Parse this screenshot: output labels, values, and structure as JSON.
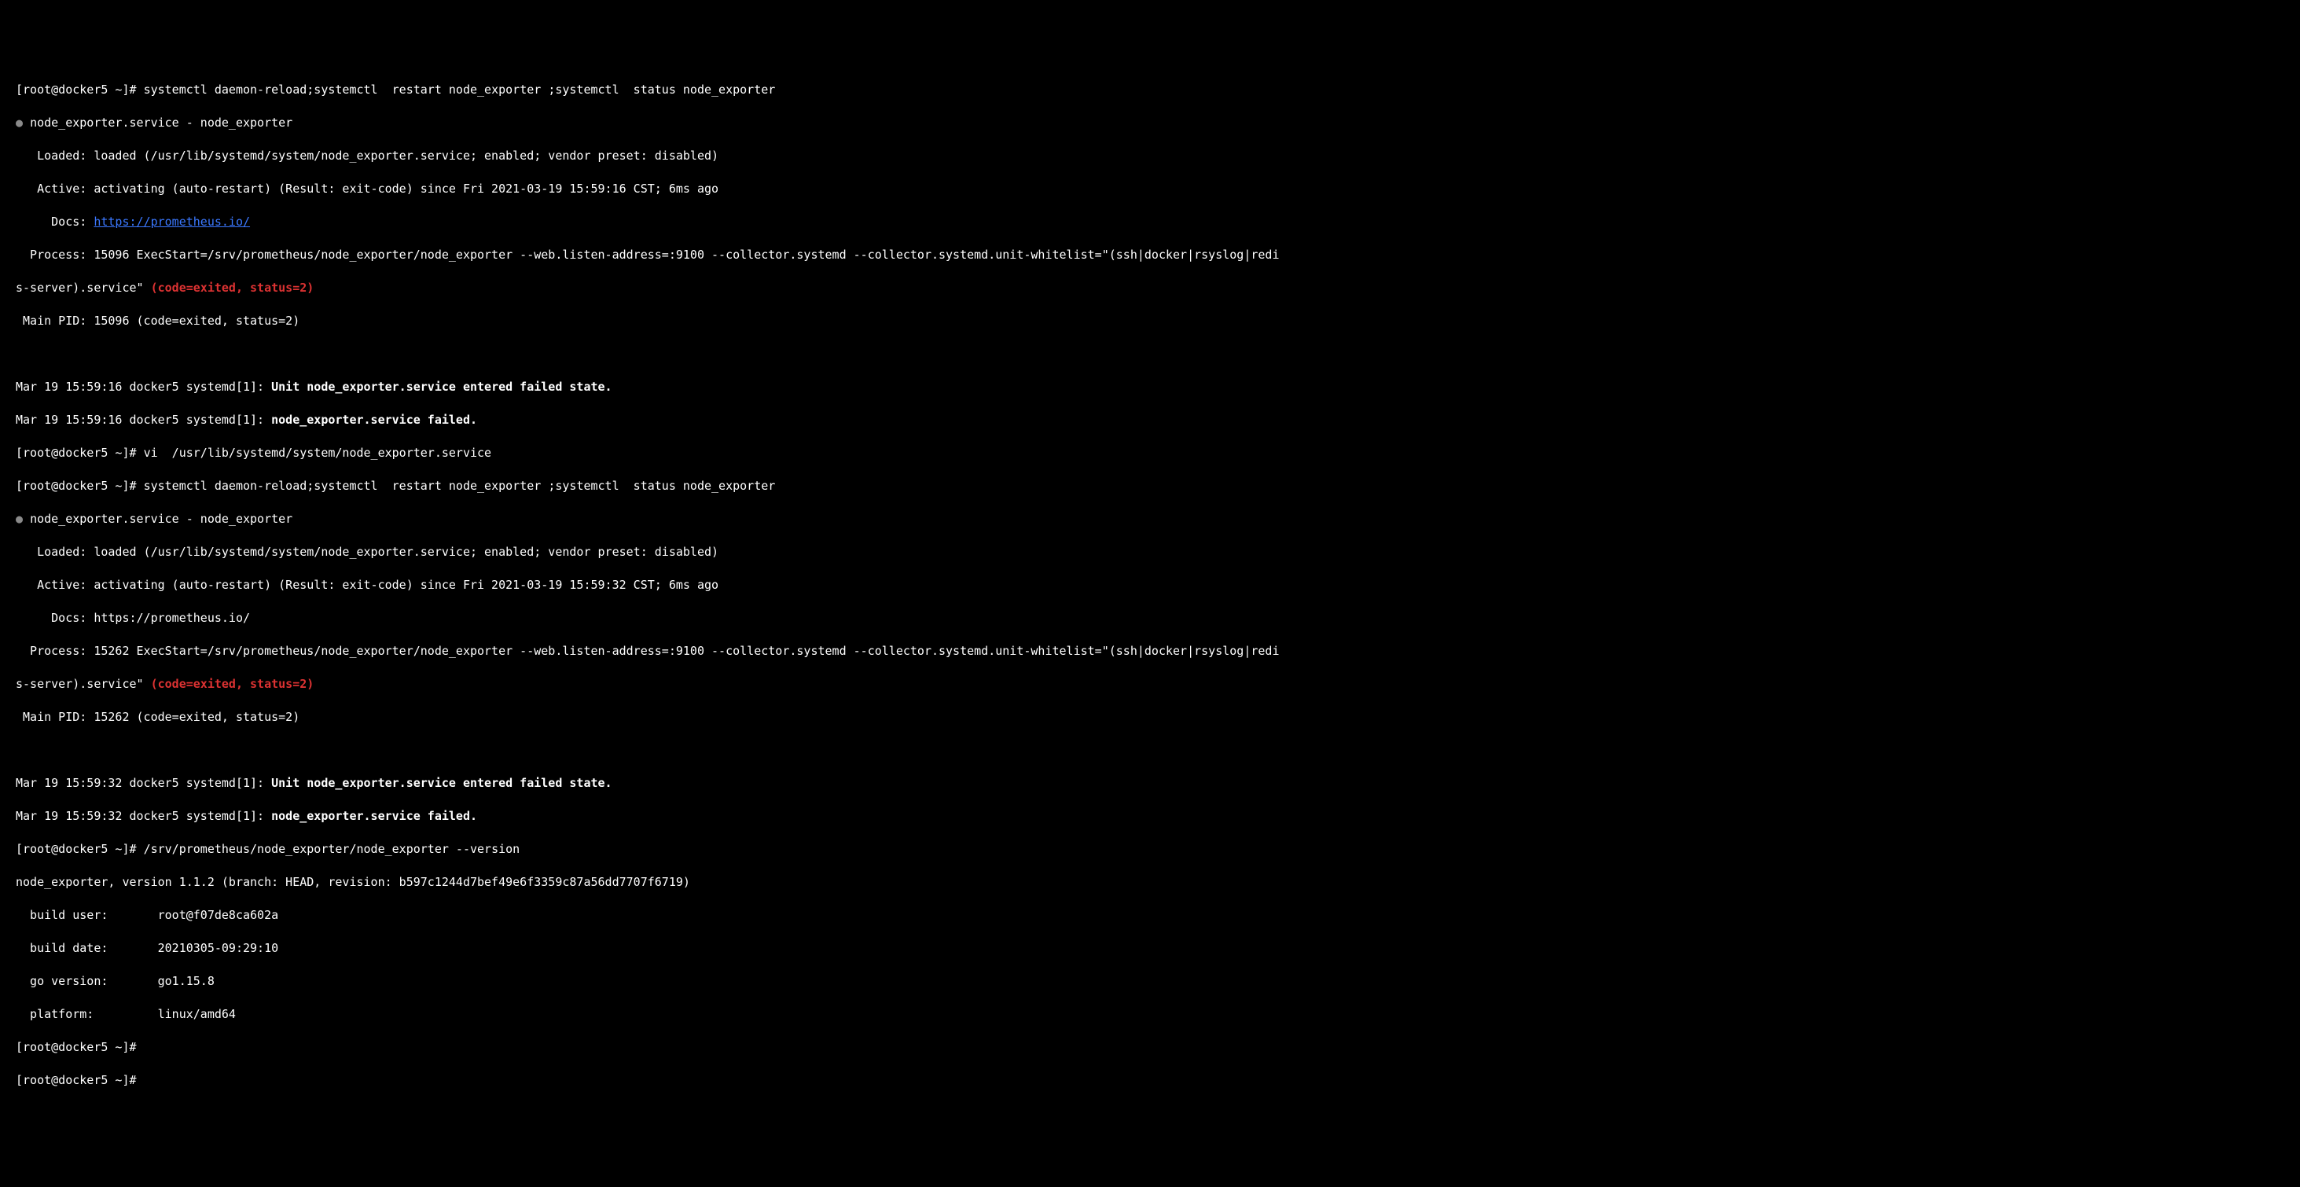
{
  "colors": {
    "bg": "#000000",
    "fg": "#ffffff",
    "red": "#dc3232",
    "link": "#3b78ff",
    "dim": "#aaaaaa"
  },
  "block1": {
    "prompt": "[root@docker5 ~]# ",
    "cmd": "systemctl daemon-reload;systemctl  restart node_exporter ;systemctl  status node_exporter",
    "bullet": "● ",
    "service_header": "node_exporter.service - node_exporter",
    "loaded": "   Loaded: loaded (/usr/lib/systemd/system/node_exporter.service; enabled; vendor preset: disabled)",
    "active": "   Active: activating (auto-restart) (Result: exit-code) since Fri 2021-03-19 15:59:16 CST; 6ms ago",
    "docs_label": "     Docs: ",
    "docs_url": "https://prometheus.io/",
    "process_a": "  Process: 15096 ExecStart=/srv/prometheus/node_exporter/node_exporter --web.listen-address=:9100 --collector.systemd --collector.systemd.unit-whitelist=\"(ssh|docker|rsyslog|redi",
    "process_b": "s-server).service\" ",
    "process_status": "(code=exited, status=2)",
    "main_pid": " Main PID: 15096 (code=exited, status=2)",
    "log1_pre": "Mar 19 15:59:16 docker5 systemd[1]: ",
    "log1_bold": "Unit node_exporter.service entered failed state.",
    "log2_pre": "Mar 19 15:59:16 docker5 systemd[1]: ",
    "log2_bold": "node_exporter.service failed."
  },
  "vi": {
    "prompt": "[root@docker5 ~]# ",
    "cmd": "vi  /usr/lib/systemd/system/node_exporter.service"
  },
  "block2": {
    "prompt": "[root@docker5 ~]# ",
    "cmd": "systemctl daemon-reload;systemctl  restart node_exporter ;systemctl  status node_exporter",
    "bullet": "● ",
    "service_header": "node_exporter.service - node_exporter",
    "loaded": "   Loaded: loaded (/usr/lib/systemd/system/node_exporter.service; enabled; vendor preset: disabled)",
    "active": "   Active: activating (auto-restart) (Result: exit-code) since Fri 2021-03-19 15:59:32 CST; 6ms ago",
    "docs": "     Docs: https://prometheus.io/",
    "process_a": "  Process: 15262 ExecStart=/srv/prometheus/node_exporter/node_exporter --web.listen-address=:9100 --collector.systemd --collector.systemd.unit-whitelist=\"(ssh|docker|rsyslog|redi",
    "process_b": "s-server).service\" ",
    "process_status": "(code=exited, status=2)",
    "main_pid": " Main PID: 15262 (code=exited, status=2)",
    "log1_pre": "Mar 19 15:59:32 docker5 systemd[1]: ",
    "log1_bold": "Unit node_exporter.service entered failed state.",
    "log2_pre": "Mar 19 15:59:32 docker5 systemd[1]: ",
    "log2_bold": "node_exporter.service failed."
  },
  "version": {
    "prompt": "[root@docker5 ~]# ",
    "cmd": "/srv/prometheus/node_exporter/node_exporter --version",
    "line": "node_exporter, version 1.1.2 (branch: HEAD, revision: b597c1244d7bef49e6f3359c87a56dd7707f6719)",
    "build_user": "  build user:       root@f07de8ca602a",
    "build_date": "  build date:       20210305-09:29:10",
    "go_version": "  go version:       go1.15.8",
    "platform": "  platform:         linux/amd64"
  },
  "tail": {
    "prompt1": "[root@docker5 ~]# ",
    "prompt2_partial": "[root@docker5 ~]#"
  }
}
